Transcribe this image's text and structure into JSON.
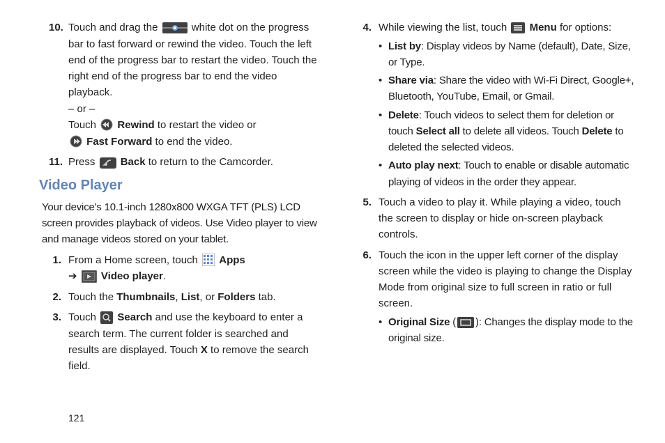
{
  "left": {
    "step10": {
      "num": "10.",
      "part1": "Touch and drag the ",
      "part2": " white dot on the progress bar to fast forward or rewind the video. Touch the left end of the progress bar to restart the video. Touch the right end of the progress bar to end the video playback.",
      "or": "– or –",
      "touch": "Touch ",
      "rewind_label": "Rewind",
      "rewind_rest": " to restart the video or",
      "ff_label": "Fast Forward",
      "ff_rest": " to end the video."
    },
    "step11": {
      "num": "11.",
      "pre": "Press ",
      "back_label": "Back",
      "rest": " to return to the Camcorder."
    },
    "heading": "Video Player",
    "intro": "Your device's 10.1-inch 1280x800 WXGA TFT (PLS) LCD screen provides playback of videos. Use Video player to view and manage videos stored on your tablet.",
    "step1": {
      "num": "1.",
      "pre": "From a Home screen, touch ",
      "apps_label": "Apps",
      "arrow": "➔",
      "vp_label": "Video player",
      "end": "."
    },
    "step2": {
      "num": "2.",
      "pre": "Touch the ",
      "thumb": "Thumbnails",
      "c1": ", ",
      "list": "List",
      "c2": ", or ",
      "folders": "Folders",
      "end": " tab."
    },
    "step3": {
      "num": "3.",
      "pre": "Touch ",
      "search_label": "Search",
      "mid": " and use the keyboard to enter a search term. The current folder is searched and results are displayed. Touch ",
      "x": "X",
      "end": " to remove the search field."
    }
  },
  "right": {
    "step4": {
      "num": "4.",
      "pre": "While viewing the list, touch ",
      "menu_label": "Menu",
      "end": " for options:",
      "b1": {
        "label": "List by",
        "rest": ": Display videos by Name (default), Date, Size, or Type."
      },
      "b2": {
        "label": "Share via",
        "rest": ": Share the video with Wi-Fi Direct, Google+, Bluetooth, YouTube, Email, or Gmail."
      },
      "b3": {
        "label": "Delete",
        "mid1": ": Touch videos to select them for deletion or touch ",
        "selall": "Select all",
        "mid2": " to delete all videos. Touch ",
        "del2": "Delete",
        "end": " to deleted the selected videos."
      },
      "b4": {
        "label": "Auto play next",
        "rest": ": Touch to enable or disable automatic playing of videos in the order they appear."
      }
    },
    "step5": {
      "num": "5.",
      "text": "Touch a video to play it. While playing a video, touch the screen to display or hide on-screen playback controls."
    },
    "step6": {
      "num": "6.",
      "text": "Touch the icon in the upper left corner of the display screen while the video is playing to change the Display Mode from original size to full screen in ratio or full screen.",
      "b1": {
        "label": "Original Size",
        "paren_open": " (",
        "paren_close": "): ",
        "rest": "Changes the display mode to the original size."
      }
    }
  },
  "page_number": "121"
}
